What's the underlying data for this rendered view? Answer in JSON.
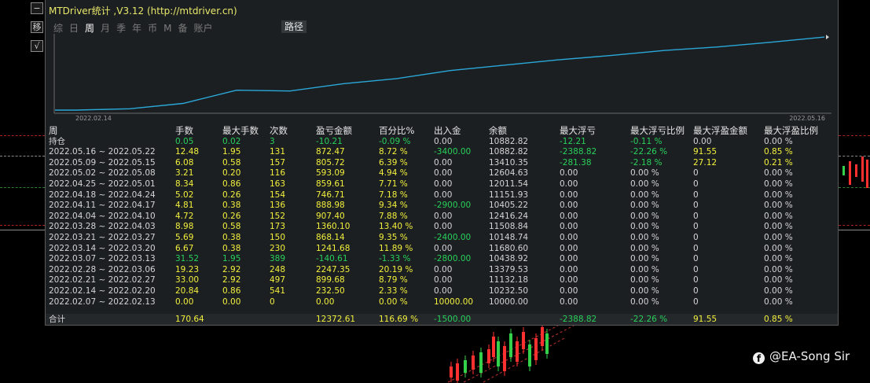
{
  "window": {
    "title": "MTDriver统计 ,V3.12 (http://mtdriver.cn)"
  },
  "left_toolbar": {
    "btn1": "−",
    "btn2": "移",
    "btn3": "√"
  },
  "tabs": [
    {
      "label": "综",
      "active": false
    },
    {
      "label": "日",
      "active": false
    },
    {
      "label": "周",
      "active": true
    },
    {
      "label": "月",
      "active": false
    },
    {
      "label": "季",
      "active": false
    },
    {
      "label": "年",
      "active": false
    },
    {
      "label": "币",
      "active": false
    },
    {
      "label": "M",
      "active": false
    },
    {
      "label": "备",
      "active": false
    },
    {
      "label": "账户",
      "active": false
    }
  ],
  "path_button": "路径",
  "chart_data": {
    "type": "line",
    "x_start_label": "2022.02.14",
    "x_end_label": "2022.05.16",
    "x": [
      "2022.02.07",
      "2022.02.14",
      "2022.02.21",
      "2022.02.28",
      "2022.03.07",
      "2022.03.14",
      "2022.03.21",
      "2022.03.28",
      "2022.04.04",
      "2022.04.11",
      "2022.04.18",
      "2022.04.25",
      "2022.05.02",
      "2022.05.09",
      "2022.05.16"
    ],
    "values": [
      0.0,
      232.5,
      1132.18,
      3379.53,
      3238.92,
      4480.6,
      5348.74,
      6708.84,
      7616.24,
      8505.22,
      9251.93,
      10111.54,
      10704.63,
      11510.35,
      12382.82
    ],
    "ylim": [
      0,
      12400
    ],
    "line_color": "#2aa8d8"
  },
  "table": {
    "headers": [
      "周",
      "手数",
      "最大手数",
      "次数",
      "盈亏金额",
      "百分比%",
      "出入金",
      "余额",
      "最大浮亏",
      "最大浮亏比例",
      "最大浮盈金额",
      "最大浮盈比例"
    ],
    "holding": {
      "label": "持仓",
      "cells": [
        "0.05",
        "0.02",
        "3",
        "-10.21",
        "-0.09 %",
        "0.00",
        "10882.82",
        "-12.21",
        "-0.11 %",
        "0.00",
        "0.00 %"
      ]
    },
    "rows": [
      [
        "2022.05.16 ~ 2022.05.22",
        "12.48",
        "1.95",
        "131",
        "872.47",
        "8.72 %",
        "-3400.00",
        "10882.82",
        "-2388.82",
        "-22.26 %",
        "91.55",
        "0.85 %"
      ],
      [
        "2022.05.09 ~ 2022.05.15",
        "6.08",
        "0.58",
        "157",
        "805.72",
        "6.39 %",
        "0.00",
        "13410.35",
        "-281.38",
        "-2.18 %",
        "27.12",
        "0.21 %"
      ],
      [
        "2022.05.02 ~ 2022.05.08",
        "3.21",
        "0.20",
        "116",
        "593.09",
        "4.94 %",
        "0.00",
        "12604.63",
        "0.00",
        "0.00 %",
        "0",
        "0.00 %"
      ],
      [
        "2022.04.25 ~ 2022.05.01",
        "8.34",
        "0.86",
        "163",
        "859.61",
        "7.71 %",
        "0.00",
        "12011.54",
        "0.00",
        "0.00 %",
        "0",
        "0.00 %"
      ],
      [
        "2022.04.18 ~ 2022.04.24",
        "5.02",
        "0.26",
        "154",
        "746.71",
        "7.18 %",
        "0.00",
        "11151.93",
        "0.00",
        "0.00 %",
        "0",
        "0.00 %"
      ],
      [
        "2022.04.11 ~ 2022.04.17",
        "4.81",
        "0.38",
        "136",
        "888.98",
        "9.34 %",
        "-2900.00",
        "10405.22",
        "0.00",
        "0.00 %",
        "0",
        "0.00 %"
      ],
      [
        "2022.04.04 ~ 2022.04.10",
        "4.72",
        "0.26",
        "152",
        "907.40",
        "7.88 %",
        "0.00",
        "12416.24",
        "0.00",
        "0.00 %",
        "0",
        "0.00 %"
      ],
      [
        "2022.03.28 ~ 2022.04.03",
        "8.98",
        "0.58",
        "173",
        "1360.10",
        "13.40 %",
        "0.00",
        "11508.84",
        "0.00",
        "0.00 %",
        "0",
        "0.00 %"
      ],
      [
        "2022.03.21 ~ 2022.03.27",
        "5.69",
        "0.38",
        "150",
        "868.14",
        "9.35 %",
        "-2400.00",
        "10148.74",
        "0.00",
        "0.00 %",
        "0",
        "0.00 %"
      ],
      [
        "2022.03.14 ~ 2022.03.20",
        "6.67",
        "0.38",
        "230",
        "1241.68",
        "11.89 %",
        "0.00",
        "11680.60",
        "0.00",
        "0.00 %",
        "0",
        "0.00 %"
      ],
      [
        "2022.03.07 ~ 2022.03.13",
        "31.52",
        "1.95",
        "389",
        "-140.61",
        "-1.33 %",
        "-2800.00",
        "10438.92",
        "0.00",
        "0.00 %",
        "0",
        "0.00 %"
      ],
      [
        "2022.02.28 ~ 2022.03.06",
        "19.23",
        "2.92",
        "248",
        "2247.35",
        "20.19 %",
        "0.00",
        "13379.53",
        "0.00",
        "0.00 %",
        "0",
        "0.00 %"
      ],
      [
        "2022.02.21 ~ 2022.02.27",
        "33.00",
        "2.92",
        "497",
        "899.68",
        "8.79 %",
        "0.00",
        "11132.18",
        "0.00",
        "0.00 %",
        "0",
        "0.00 %"
      ],
      [
        "2022.02.14 ~ 2022.02.20",
        "20.84",
        "0.86",
        "541",
        "232.50",
        "2.33 %",
        "0.00",
        "10232.50",
        "0.00",
        "0.00 %",
        "0",
        "0.00 %"
      ],
      [
        "2022.02.07 ~ 2022.02.13",
        "0.00",
        "0.00",
        "0",
        "0.00",
        "0.00 %",
        "10000.00",
        "10000.00",
        "0.00",
        "0.00 %",
        "0",
        "0.00 %"
      ]
    ],
    "total": {
      "label": "合计",
      "cells": [
        "170.64",
        "",
        "",
        "12372.61",
        "116.69 %",
        "-1500.00",
        "",
        "-2388.82",
        "-22.26 %",
        "91.55",
        "0.85 %"
      ]
    }
  },
  "watermark": {
    "icon": "facebook-icon",
    "text": "@EA-Song Sir"
  },
  "colors": {
    "yellow": "#f2f03c",
    "green": "#28d05a",
    "panel": "#1c1f22"
  }
}
